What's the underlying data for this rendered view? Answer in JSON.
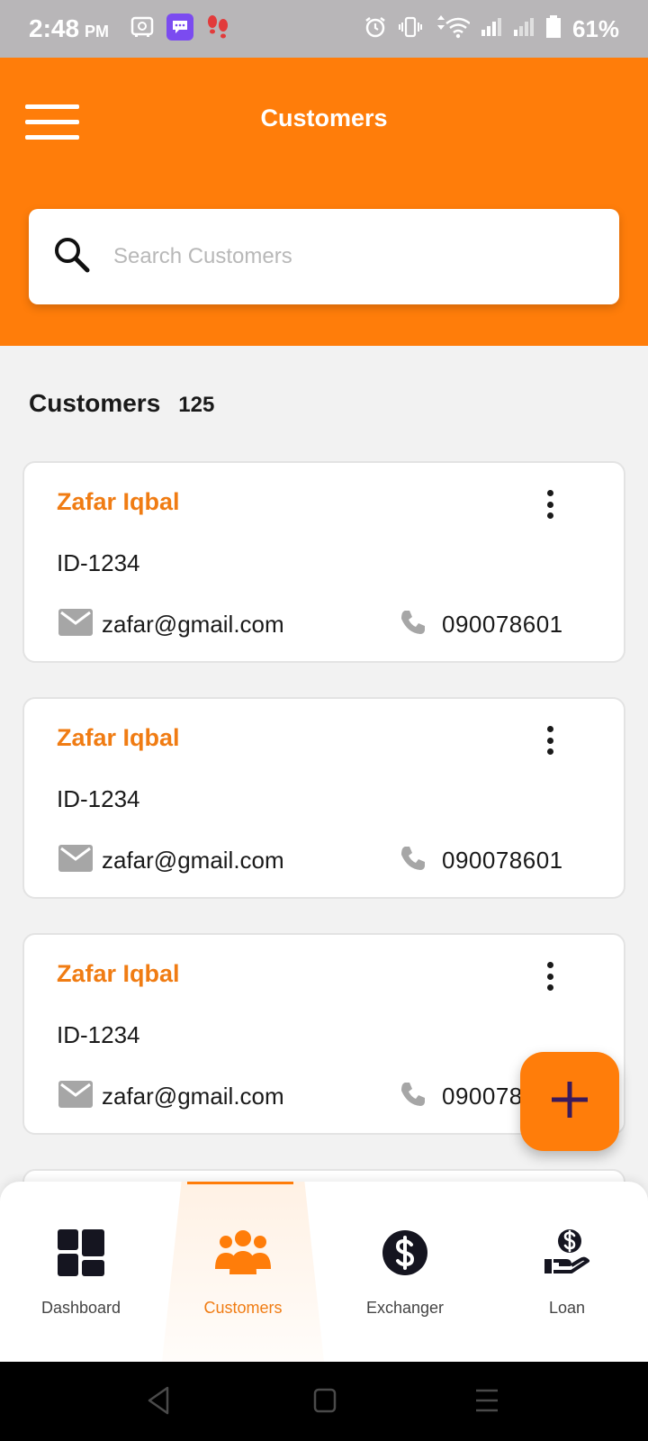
{
  "status_bar": {
    "time": "2:48",
    "ampm": "PM",
    "battery": "61%",
    "icons": [
      "vault-icon",
      "chat-icon",
      "footsteps-icon",
      "alarm-icon",
      "vibrate-icon",
      "data-arrows-icon",
      "wifi-icon",
      "signal-icon",
      "signal-icon",
      "battery-icon"
    ]
  },
  "header": {
    "title": "Customers",
    "menu_icon": "hamburger-menu-icon"
  },
  "search": {
    "placeholder": "Search Customers",
    "value": "",
    "icon": "search-icon"
  },
  "summary": {
    "label": "Customers",
    "count": "125"
  },
  "customers": [
    {
      "name": "Zafar Iqbal",
      "id": "ID-1234",
      "email": "zafar@gmail.com",
      "phone": "090078601"
    },
    {
      "name": "Zafar Iqbal",
      "id": "ID-1234",
      "email": "zafar@gmail.com",
      "phone": "090078601"
    },
    {
      "name": "Zafar Iqbal",
      "id": "ID-1234",
      "email": "zafar@gmail.com",
      "phone": "090078601"
    }
  ],
  "fab": {
    "icon": "plus-icon"
  },
  "bottom_nav": {
    "items": [
      {
        "label": "Dashboard",
        "icon": "dashboard-grid-icon",
        "active": false
      },
      {
        "label": "Customers",
        "icon": "people-group-icon",
        "active": true
      },
      {
        "label": "Exchanger",
        "icon": "dollar-circle-icon",
        "active": false
      },
      {
        "label": "Loan",
        "icon": "hand-dollar-icon",
        "active": false
      }
    ]
  },
  "system_nav": [
    "back-icon",
    "home-icon",
    "recents-icon"
  ],
  "colors": {
    "brand_orange": "#ff7d0a",
    "name_orange": "#f07c13",
    "fab_plus": "#3b1a5a",
    "background": "#f2f2f2"
  }
}
